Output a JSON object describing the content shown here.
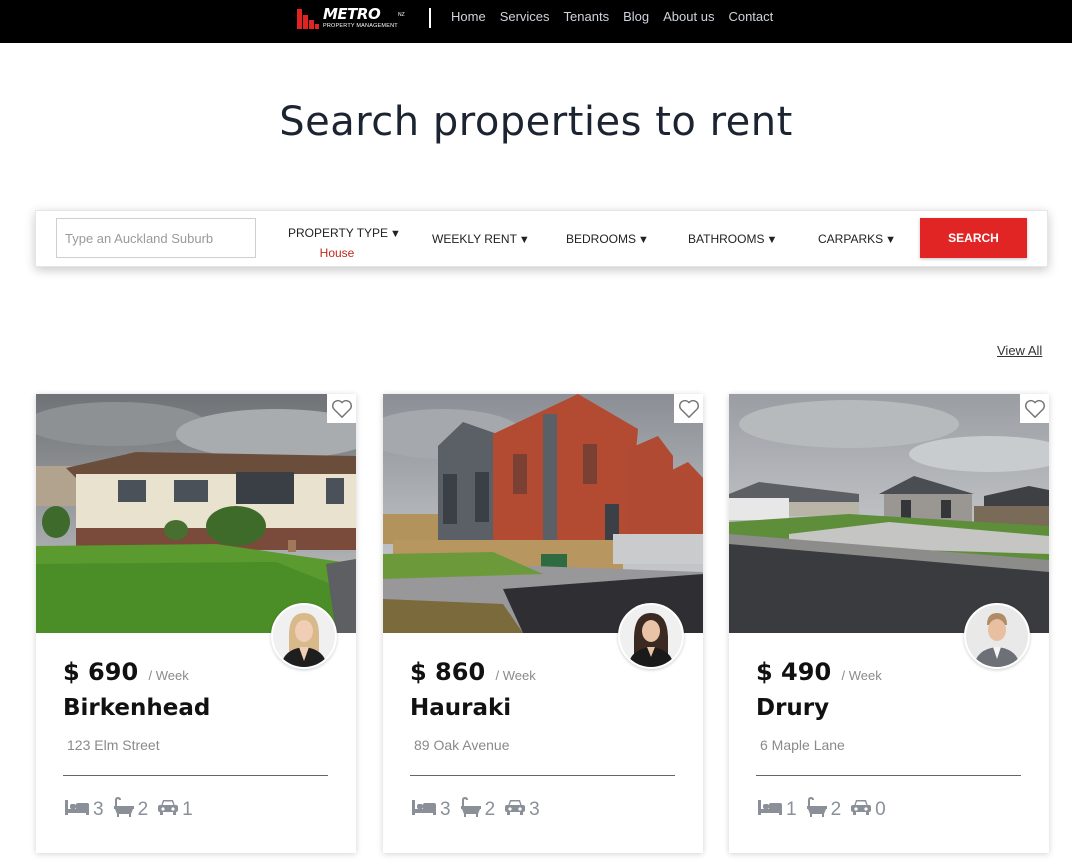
{
  "nav": {
    "logo_word": "METRO",
    "logo_sub": "PROPERTY MANAGEMENT",
    "logo_nz": "NZ",
    "links": [
      "Home",
      "Services",
      "Tenants",
      "Blog",
      "About us",
      "Contact"
    ]
  },
  "hero": {
    "title": "Search properties to rent"
  },
  "search": {
    "suburb_placeholder": "Type an Auckland Suburb",
    "property_type_label": "PROPERTY TYPE",
    "property_type_value": "House",
    "weekly_rent_label": "WEEKLY RENT",
    "bedrooms_label": "BEDROOMS",
    "bathrooms_label": "BATHROOMS",
    "carparks_label": "CARPARKS",
    "caret": "▼",
    "button_label": "SEARCH"
  },
  "view_all": "View All",
  "colors": {
    "accent": "#e02524",
    "nav_bg": "#000000",
    "title": "#1d2431"
  },
  "listings": [
    {
      "price": "$ 690",
      "per": "/ Week",
      "suburb": "Birkenhead",
      "address": "123 Elm Street",
      "beds": "3",
      "baths": "2",
      "cars": "1"
    },
    {
      "price": "$ 860",
      "per": "/ Week",
      "suburb": "Hauraki",
      "address": "89 Oak Avenue",
      "beds": "3",
      "baths": "2",
      "cars": "3"
    },
    {
      "price": "$ 490",
      "per": "/ Week",
      "suburb": "Drury",
      "address": "6 Maple Lane",
      "beds": "1",
      "baths": "2",
      "cars": "0"
    }
  ],
  "icons": {
    "favorite": "heart-outline-icon",
    "bed": "bed-icon",
    "bath": "bath-icon",
    "car": "car-icon"
  }
}
